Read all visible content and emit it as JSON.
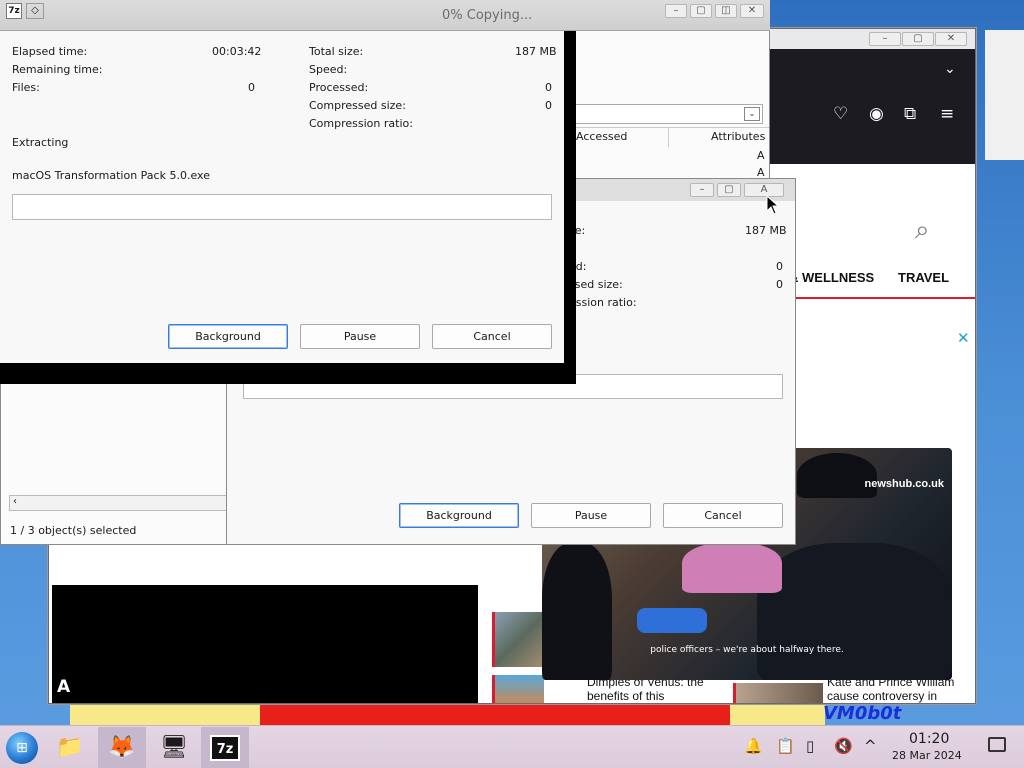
{
  "colors": {
    "accent_blue": "#3b7ad8",
    "brand_red": "#d81e2c",
    "taskbar": "#e5d6e4",
    "ad_close": "#19a6c9"
  },
  "wallpaper": {
    "stamp": "VM0b0t"
  },
  "browser": {
    "nav_items": [
      "& WELLNESS",
      "TRAVEL"
    ],
    "icons": [
      "chevron-down-icon",
      "pocket-icon",
      "account-icon",
      "extensions-icon",
      "menu-icon",
      "search-icon"
    ],
    "articles": [
      {
        "title": "Dimples of Venus: the benefits of this"
      },
      {
        "title": "Kate and Prince William cause controversy in"
      }
    ],
    "news_video": {
      "brand": "newshub.co.uk",
      "caption": "police officers – we're about halfway there."
    }
  },
  "file_manager": {
    "columns": [
      "Accessed",
      "Attributes"
    ],
    "attributes": [
      "A",
      "A"
    ],
    "status": "1 / 3 object(s) selected"
  },
  "dialog_back": {
    "labels": {
      "total_size_partial": "ze:",
      "total_size_value": "187 MB",
      "speed_partial": "ed:",
      "processed_value": "0",
      "compressed_partial": "ssed size:",
      "compressed_value": "0",
      "ratio_partial": "ession ratio:"
    },
    "progress_percent": 0,
    "buttons": {
      "background": "Background",
      "pause": "Pause",
      "cancel": "Cancel"
    },
    "titlebar_fragment": "A"
  },
  "dialog_front": {
    "title": "0% Copying...",
    "elapsed_label": "Elapsed time:",
    "elapsed_value": "00:03:42",
    "remaining_label": "Remaining time:",
    "files_label": "Files:",
    "files_value": "0",
    "total_size_label": "Total size:",
    "total_size_value": "187 MB",
    "speed_label": "Speed:",
    "processed_label": "Processed:",
    "processed_value": "0",
    "compressed_label": "Compressed size:",
    "compressed_value": "0",
    "ratio_label": "Compression ratio:",
    "operation": "Extracting",
    "current_file": "macOS Transformation Pack 5.0.exe",
    "progress_percent": 0,
    "buttons": {
      "background": "Background",
      "pause": "Pause",
      "cancel": "Cancel"
    }
  },
  "taskbar": {
    "apps": [
      "file-explorer",
      "firefox",
      "remote-desktop",
      "7-zip"
    ],
    "seven_zip_label": "7z",
    "clock_time": "01:20",
    "clock_date": "28 Mar 2024"
  }
}
